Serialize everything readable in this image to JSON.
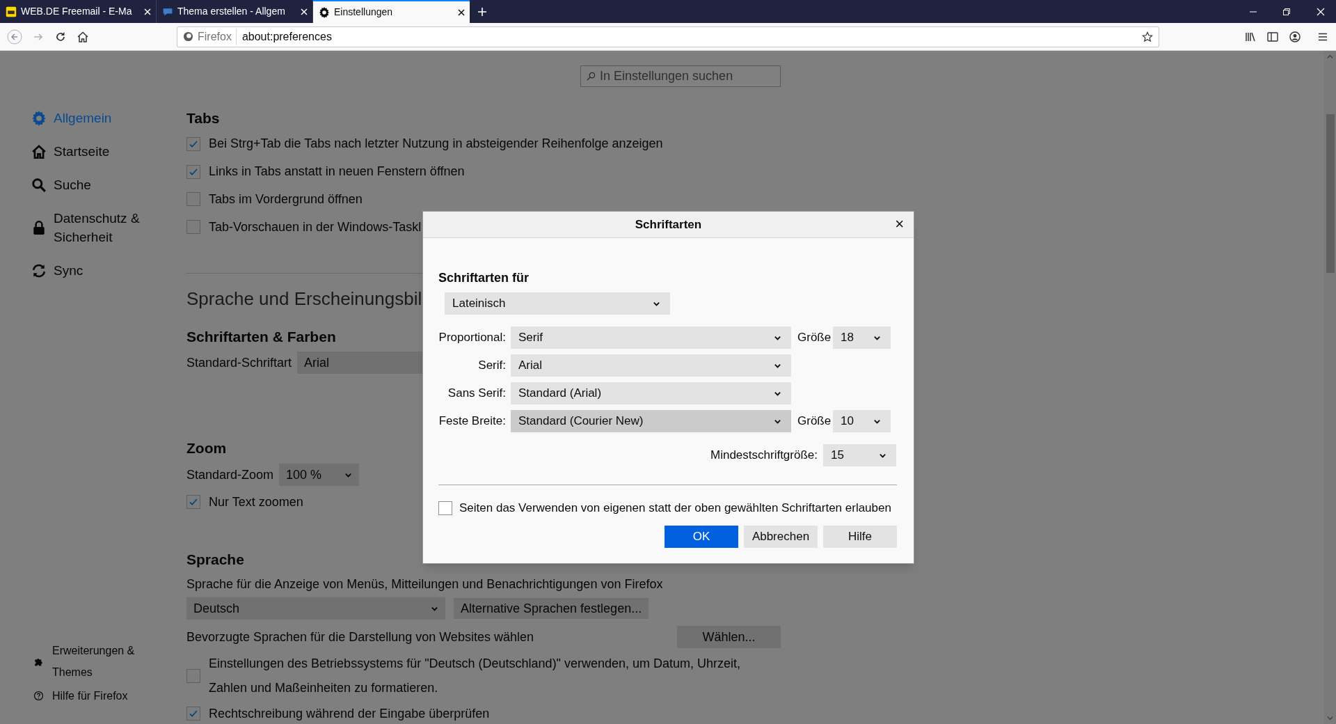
{
  "browser": {
    "tabs": [
      {
        "title": "WEB.DE Freemail - E-Ma",
        "selected": false
      },
      {
        "title": "Thema erstellen - Allgem",
        "selected": false
      },
      {
        "title": "Einstellungen",
        "selected": true
      }
    ],
    "identity": "Firefox",
    "url": "about:preferences"
  },
  "search": {
    "placeholder": "In Einstellungen suchen"
  },
  "sidebar": {
    "items": [
      {
        "label": "Allgemein",
        "selected": true
      },
      {
        "label": "Startseite",
        "selected": false
      },
      {
        "label": "Suche",
        "selected": false
      },
      {
        "label": "Datenschutz & Sicherheit",
        "selected": false
      },
      {
        "label": "Sync",
        "selected": false
      }
    ],
    "footer": [
      {
        "label": "Erweiterungen & Themes"
      },
      {
        "label": "Hilfe für Firefox"
      }
    ]
  },
  "tabs_section": {
    "heading": "Tabs",
    "options": [
      {
        "label": "Bei Strg+Tab die Tabs nach letzter Nutzung in absteigender Reihenfolge anzeigen",
        "checked": true
      },
      {
        "label": "Links in Tabs anstatt in neuen Fenstern öffnen",
        "checked": true
      },
      {
        "label": "Tabs im Vordergrund öffnen",
        "checked": false
      },
      {
        "label": "Tab-Vorschauen in der Windows-Taskl",
        "checked": false
      }
    ]
  },
  "language_appearance": {
    "heading": "Sprache und Erscheinungsbil",
    "fonts_heading": "Schriftarten & Farben",
    "default_font_label": "Standard-Schriftart",
    "default_font": "Arial"
  },
  "zoom": {
    "heading": "Zoom",
    "default_zoom_label": "Standard-Zoom",
    "default_zoom": "100 %",
    "text_only": {
      "label": "Nur Text zoomen",
      "checked": true
    }
  },
  "language": {
    "heading": "Sprache",
    "description": "Sprache für die Anzeige von Menüs, Mitteilungen und Benachrichtigungen von Firefox",
    "ui_language": "Deutsch",
    "alternatives_button": "Alternative Sprachen festlegen...",
    "web_languages_label": "Bevorzugte Sprachen für die Darstellung von Websites wählen",
    "choose_button": "Wählen...",
    "options": [
      {
        "label": "Einstellungen des Betriebssystems für \"Deutsch (Deutschland)\" verwenden, um Datum, Uhrzeit, Zahlen und Maßeinheiten zu formatieren.",
        "checked": false
      },
      {
        "label": "Rechtschreibung während der Eingabe überprüfen",
        "checked": true
      }
    ]
  },
  "dialog": {
    "title": "Schriftarten",
    "close": "×",
    "heading": "Schriftarten für",
    "script": "Lateinisch",
    "rows": [
      {
        "label": "Proportional:",
        "value": "Serif",
        "focused": false,
        "size_label": "Größe",
        "size": "18"
      },
      {
        "label": "Serif:",
        "value": "Arial",
        "focused": false
      },
      {
        "label": "Sans Serif:",
        "value": "Standard (Arial)",
        "focused": false
      },
      {
        "label": "Feste Breite:",
        "value": "Standard (Courier New)",
        "focused": true,
        "size_label": "Größe",
        "size": "10"
      }
    ],
    "min_size_label": "Mindestschriftgröße:",
    "min_size": "15",
    "allow_page_fonts": {
      "label": "Seiten das Verwenden von eigenen statt der oben gewählten Schriftarten erlauben",
      "checked": false
    },
    "buttons": [
      {
        "label": "OK",
        "kind": "primary"
      },
      {
        "label": "Abbrechen",
        "kind": "default"
      },
      {
        "label": "Hilfe",
        "kind": "default"
      }
    ]
  }
}
